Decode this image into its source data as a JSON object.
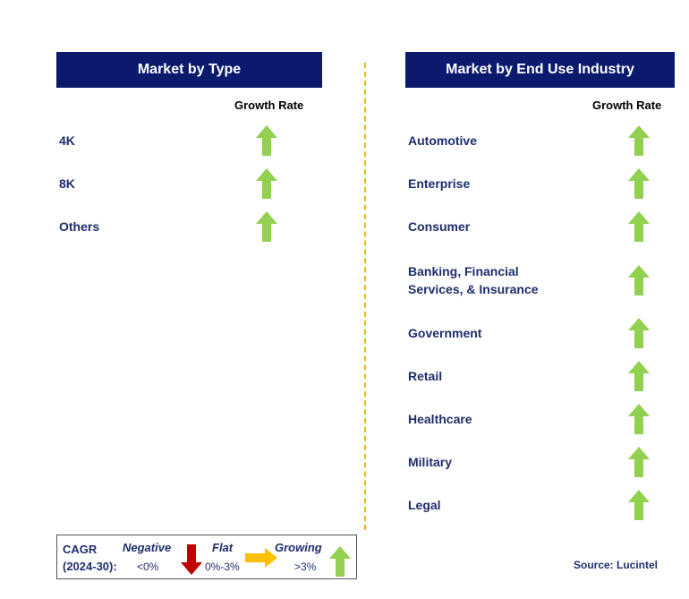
{
  "left": {
    "title": "Market by Type",
    "growth_header": "Growth Rate",
    "items": [
      {
        "label": "4K",
        "trend": "growing"
      },
      {
        "label": "8K",
        "trend": "growing"
      },
      {
        "label": "Others",
        "trend": "growing"
      }
    ]
  },
  "right": {
    "title": "Market by End Use Industry",
    "growth_header": "Growth Rate",
    "items": [
      {
        "label": "Automotive",
        "trend": "growing"
      },
      {
        "label": "Enterprise",
        "trend": "growing"
      },
      {
        "label": "Consumer",
        "trend": "growing"
      },
      {
        "label": "Banking, Financial Services, & Insurance",
        "trend": "growing"
      },
      {
        "label": "Government",
        "trend": "growing"
      },
      {
        "label": "Retail",
        "trend": "growing"
      },
      {
        "label": "Healthcare",
        "trend": "growing"
      },
      {
        "label": "Military",
        "trend": "growing"
      },
      {
        "label": "Legal",
        "trend": "growing"
      }
    ]
  },
  "legend": {
    "cagr": "CAGR",
    "period": "(2024-30):",
    "negative": "Negative",
    "negative_range": "<0%",
    "flat": "Flat",
    "flat_range": "0%-3%",
    "growing": "Growing",
    "growing_range": ">3%"
  },
  "colors": {
    "header": "#0c1a6e",
    "growing": "#92d050",
    "flat": "#ffc000",
    "negative": "#c00000",
    "divider": "#f5b800"
  },
  "source": "Source: Lucintel"
}
